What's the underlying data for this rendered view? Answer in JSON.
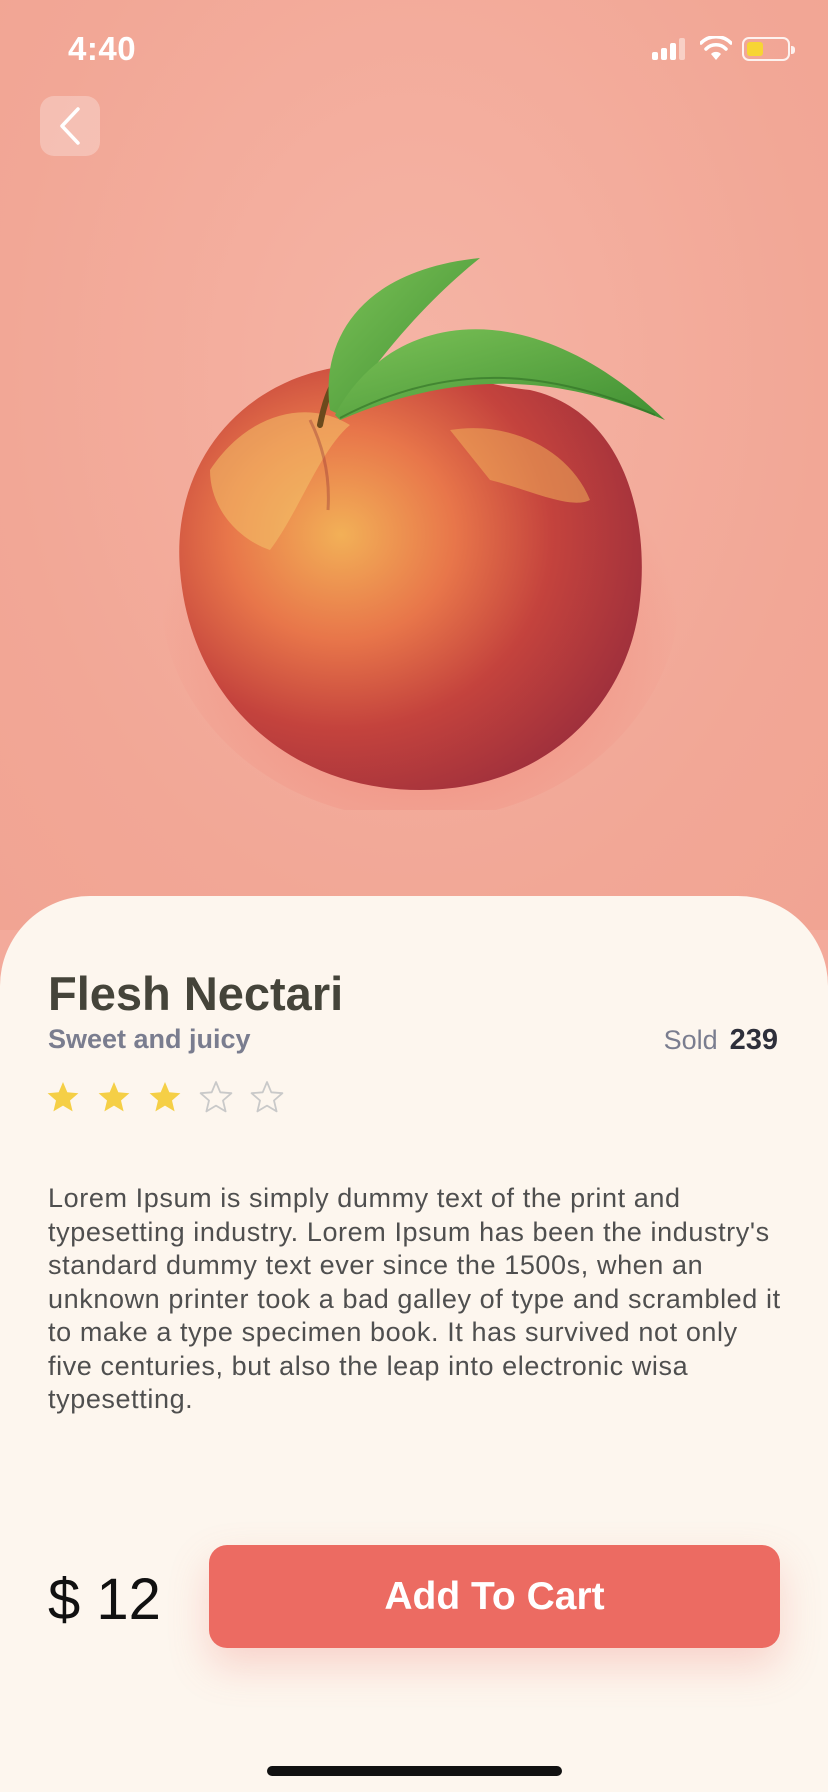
{
  "status": {
    "time": "4:40"
  },
  "product": {
    "name": "Flesh Nectari",
    "tagline": "Sweet and juicy",
    "sold_label": "Sold",
    "sold_count": "239",
    "rating": 3,
    "rating_max": 5,
    "description": "Lorem Ipsum is simply dummy text of the print and typesetting industry. Lorem Ipsum has been the industry's standard dummy text ever since the 1500s, when an unknown printer took a bad galley of type and scrambled it to make a type specimen book. It has survived not only five centuries, but also the leap into electronic wisa typesetting.",
    "price": "$ 12"
  },
  "actions": {
    "add_to_cart": "Add To Cart"
  },
  "icons": {
    "back": "chevron-left-icon",
    "signal": "signal-icon",
    "wifi": "wifi-icon",
    "battery": "battery-icon",
    "star": "star-icon"
  },
  "colors": {
    "hero_bg": "#f3aa9b",
    "sheet_bg": "#fdf6ee",
    "accent": "#ec6b62",
    "star_filled": "#f5cf46",
    "star_empty": "#c9c9c9",
    "battery_level": "#f7d534"
  }
}
